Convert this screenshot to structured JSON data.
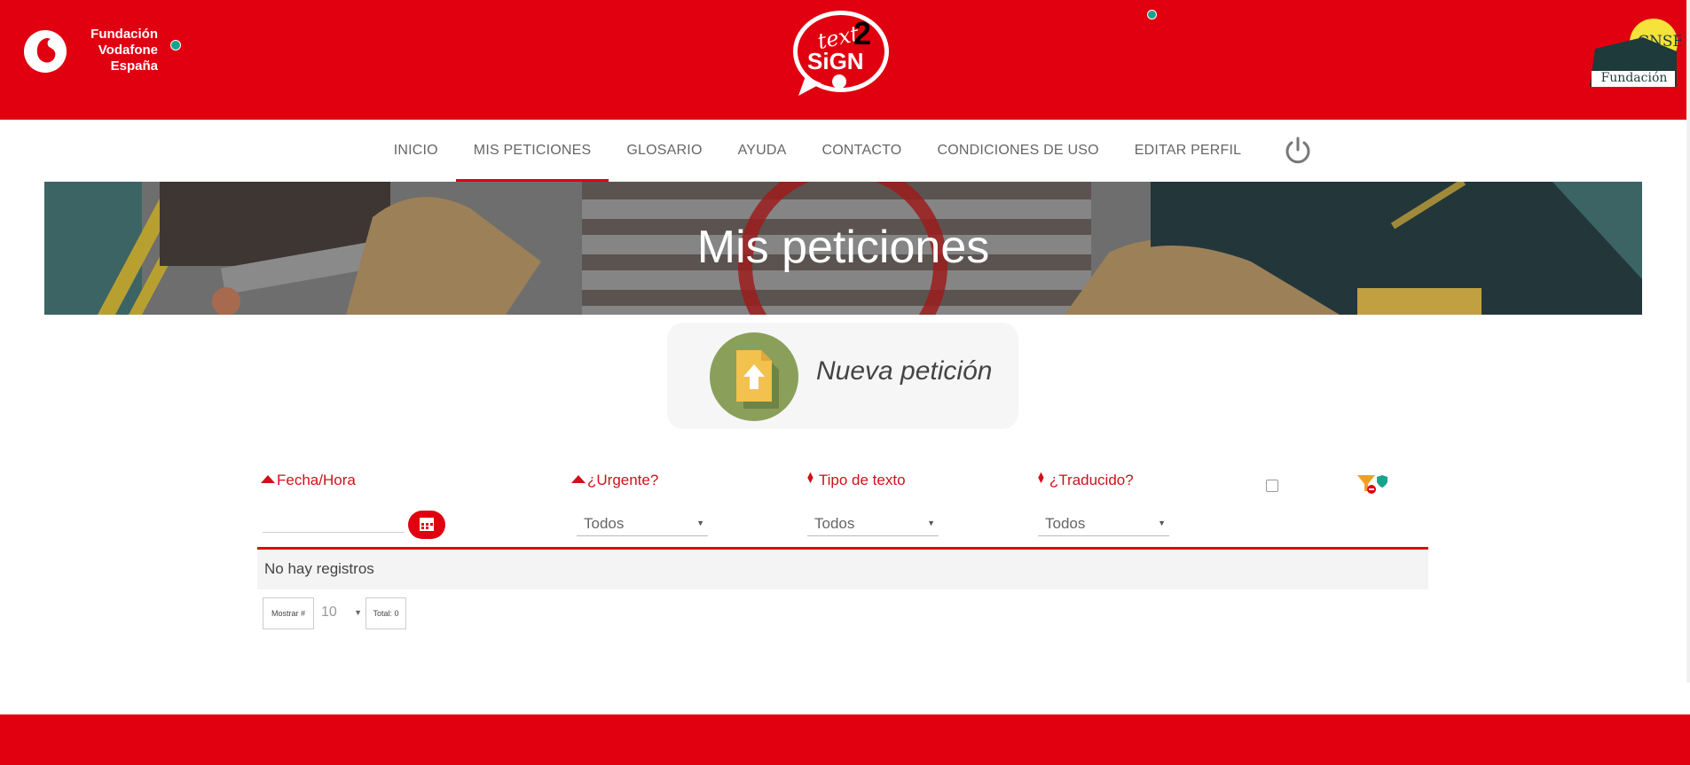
{
  "header": {
    "vodafone_lines": [
      "Fundación",
      "Vodafone",
      "España"
    ],
    "logo_text2sign": "text 2 SiGN",
    "cnse_label": "CNSE",
    "cnse_fundacion": "Fundación"
  },
  "nav": {
    "items": [
      {
        "label": "INICIO",
        "active": false
      },
      {
        "label": "MIS PETICIONES",
        "active": true
      },
      {
        "label": "GLOSARIO",
        "active": false
      },
      {
        "label": "AYUDA",
        "active": false
      },
      {
        "label": "CONTACTO",
        "active": false
      },
      {
        "label": "CONDICIONES DE USO",
        "active": false
      },
      {
        "label": "EDITAR PERFIL",
        "active": false
      }
    ],
    "logout_icon": "power-icon"
  },
  "banner": {
    "title": "Mis peticiones"
  },
  "new_request": {
    "label": "Nueva petición",
    "icon": "file-upload-icon"
  },
  "table": {
    "columns": [
      {
        "label": "Fecha/Hora",
        "sort": "asc"
      },
      {
        "label": "¿Urgente?",
        "sort": "asc"
      },
      {
        "label": "Tipo de texto",
        "sort": "none"
      },
      {
        "label": "¿Traducido?",
        "sort": "none"
      }
    ],
    "filters": {
      "urgente": "Todos",
      "tipo": "Todos",
      "traducido": "Todos"
    },
    "empty_message": "No hay registros"
  },
  "pager": {
    "show_label": "Mostrar #",
    "page_size": "10",
    "total_label": "Total: 0"
  },
  "colors": {
    "brand_red": "#e0000f",
    "link_red": "#d0101a",
    "accent_green": "#8aa05a"
  }
}
